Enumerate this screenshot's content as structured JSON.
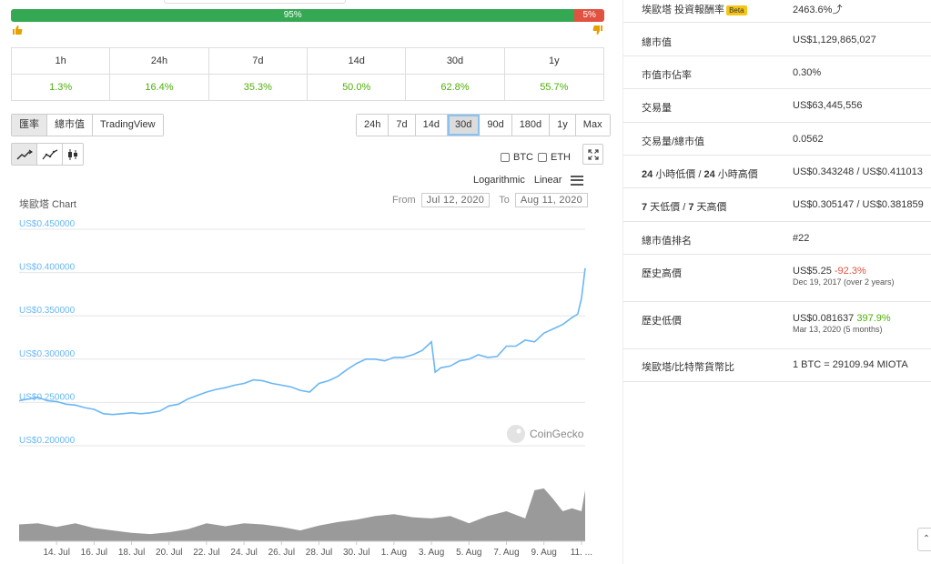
{
  "sentiment": {
    "up_label": "95%",
    "down_label": "5%",
    "up_pct": 95,
    "down_pct": 5
  },
  "change_table": {
    "headers": [
      "1h",
      "24h",
      "7d",
      "14d",
      "30d",
      "1y"
    ],
    "values": [
      "1.3%",
      "16.4%",
      "35.3%",
      "50.0%",
      "62.8%",
      "55.7%"
    ]
  },
  "type_tabs": [
    "匯率",
    "總市值",
    "TradingView"
  ],
  "range_tabs": [
    "24h",
    "7d",
    "14d",
    "30d",
    "90d",
    "180d",
    "1y",
    "Max"
  ],
  "active_range": "30d",
  "compare": {
    "btc": "BTC",
    "eth": "ETH"
  },
  "scale": {
    "log": "Logarithmic",
    "linear": "Linear"
  },
  "chart_header": {
    "title": "埃歐塔 Chart",
    "from_label": "From",
    "from_date": "Jul 12, 2020",
    "to_label": "To",
    "to_date": "Aug 11, 2020"
  },
  "watermark": "CoinGecko",
  "colors": {
    "line": "#6ab7f5",
    "volume": "#888888",
    "green": "#4eaf0a",
    "red": "#e15241",
    "up_bar": "#34a853",
    "down_bar": "#e15241"
  },
  "chart_data": {
    "type": "line",
    "title": "埃歐塔 Chart",
    "ylim": [
      0.2,
      0.45
    ],
    "yticks": [
      "US$0.450000",
      "US$0.400000",
      "US$0.350000",
      "US$0.300000",
      "US$0.250000",
      "US$0.200000"
    ],
    "ytick_values": [
      0.45,
      0.4,
      0.35,
      0.3,
      0.25,
      0.2
    ],
    "xticks": [
      "14. Jul",
      "16. Jul",
      "18. Jul",
      "20. Jul",
      "22. Jul",
      "24. Jul",
      "26. Jul",
      "28. Jul",
      "30. Jul",
      "1. Aug",
      "3. Aug",
      "5. Aug",
      "7. Aug",
      "9. Aug",
      "11. ..."
    ],
    "xtick_days": [
      2,
      4,
      6,
      8,
      10,
      12,
      14,
      16,
      18,
      20,
      22,
      24,
      26,
      28,
      30
    ],
    "price_series": {
      "days": [
        0,
        0.5,
        1,
        1.5,
        2,
        2.5,
        3,
        3.5,
        4,
        4.5,
        5,
        5.5,
        6,
        6.5,
        7,
        7.5,
        8,
        8.5,
        9,
        9.5,
        10,
        10.5,
        11,
        11.5,
        12,
        12.5,
        13,
        13.5,
        14,
        14.5,
        15,
        15.5,
        16,
        16.5,
        17,
        17.5,
        18,
        18.5,
        19,
        19.5,
        20,
        20.5,
        21,
        21.5,
        22,
        22.2,
        22.5,
        23,
        23.5,
        24,
        24.5,
        25,
        25.5,
        26,
        26.5,
        27,
        27.5,
        28,
        28.5,
        29,
        29.5,
        29.8,
        30,
        30.2
      ],
      "values": [
        0.252,
        0.254,
        0.256,
        0.252,
        0.251,
        0.248,
        0.247,
        0.244,
        0.242,
        0.237,
        0.236,
        0.237,
        0.238,
        0.237,
        0.238,
        0.24,
        0.246,
        0.248,
        0.254,
        0.258,
        0.262,
        0.265,
        0.267,
        0.27,
        0.272,
        0.276,
        0.275,
        0.272,
        0.27,
        0.268,
        0.264,
        0.262,
        0.272,
        0.275,
        0.28,
        0.288,
        0.295,
        0.3,
        0.3,
        0.298,
        0.302,
        0.302,
        0.305,
        0.31,
        0.32,
        0.285,
        0.29,
        0.292,
        0.298,
        0.3,
        0.305,
        0.302,
        0.303,
        0.315,
        0.315,
        0.322,
        0.32,
        0.33,
        0.335,
        0.34,
        0.348,
        0.352,
        0.37,
        0.405
      ]
    },
    "volume_series": {
      "days": [
        0,
        1,
        2,
        3,
        4,
        5,
        6,
        7,
        8,
        9,
        10,
        11,
        12,
        13,
        14,
        15,
        16,
        17,
        18,
        19,
        20,
        21,
        22,
        23,
        24,
        25,
        26,
        27,
        27.5,
        28,
        28.5,
        29,
        29.5,
        30,
        30.2
      ],
      "values": [
        0.28,
        0.3,
        0.24,
        0.3,
        0.22,
        0.18,
        0.14,
        0.12,
        0.15,
        0.2,
        0.3,
        0.25,
        0.3,
        0.28,
        0.24,
        0.18,
        0.26,
        0.32,
        0.36,
        0.42,
        0.45,
        0.4,
        0.38,
        0.42,
        0.3,
        0.42,
        0.5,
        0.38,
        0.85,
        0.88,
        0.7,
        0.5,
        0.55,
        0.5,
        0.85
      ]
    }
  },
  "stats": [
    {
      "label": "埃歐塔 投資報酬率",
      "badge": "Beta",
      "value": "2463.6%",
      "value_color": "green",
      "arrow": "⤴"
    },
    {
      "label": "總市值",
      "value": "US$1,129,865,027"
    },
    {
      "label": "市值市佔率",
      "value": "0.30%"
    },
    {
      "label": "交易量",
      "value": "US$63,445,556"
    },
    {
      "label": "交易量/總市值",
      "value": "0.0562"
    },
    {
      "label_bold_1": "24",
      "label_mid": " 小時低價 / ",
      "label_bold_2": "24",
      "label_end": " 小時高價",
      "value": "US$0.343248 / US$0.411013"
    },
    {
      "label_bold_1": "7",
      "label_mid": " 天低價 / ",
      "label_bold_2": "7",
      "label_end": " 天高價",
      "value": "US$0.305147 / US$0.381859"
    },
    {
      "label": "總市值排名",
      "value": "#22"
    },
    {
      "label": "歷史高價",
      "value": "US$5.25",
      "change": "-92.3%",
      "change_color": "red",
      "sub": "Dec 19, 2017 (over 2 years)"
    },
    {
      "label": "歷史低價",
      "value": "US$0.081637",
      "change": "397.9%",
      "change_color": "green",
      "sub": "Mar 13, 2020 (5 months)"
    },
    {
      "label": "埃歐塔/比特幣貨幣比",
      "value": "1 BTC = 29109.94 MIOTA"
    }
  ]
}
